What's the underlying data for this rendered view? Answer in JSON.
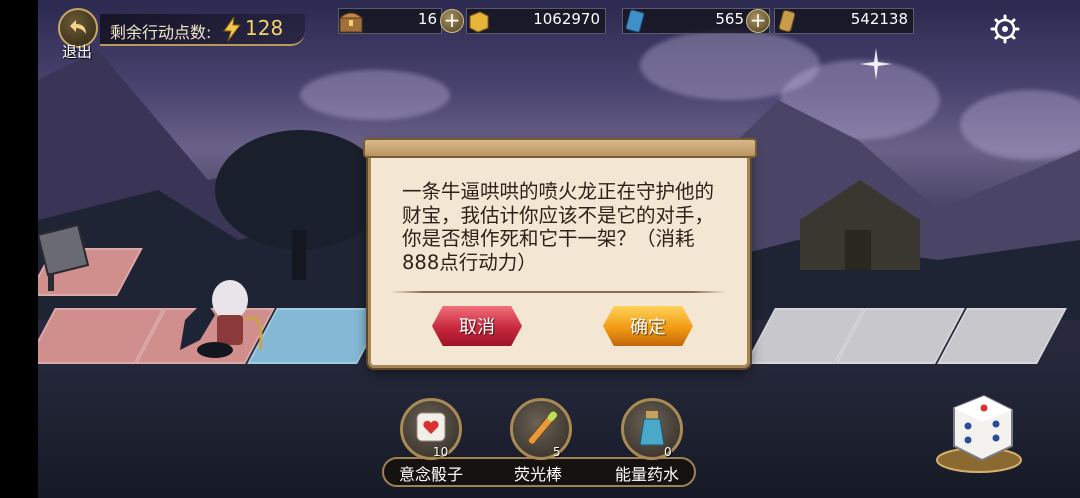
{
  "top_bar": {
    "exit_label": "退出",
    "action_points_label": "剩余行动点数:",
    "action_points_value": "128"
  },
  "resources": [
    {
      "icon": "treasure-chest-icon",
      "value": "16",
      "has_plus": true
    },
    {
      "icon": "gold-coin-icon",
      "value": "1062970",
      "has_plus": false
    },
    {
      "icon": "blue-gem-icon",
      "value": "565",
      "has_plus": true
    },
    {
      "icon": "bronze-coin-icon",
      "value": "542138",
      "has_plus": false
    }
  ],
  "dialog": {
    "message": "一条牛逼哄哄的喷火龙正在守护他的财宝，我估计你应该不是它的对手，你是否想作死和它干一架？（消耗888点行动力）",
    "cancel_label": "取消",
    "confirm_label": "确定"
  },
  "items": [
    {
      "icon": "heart-dice-icon",
      "count": "10",
      "label": "意念骰子"
    },
    {
      "icon": "glow-stick-icon",
      "count": "5",
      "label": "荧光棒"
    },
    {
      "icon": "potion-bottle-icon",
      "count": "0",
      "label": "能量药水"
    }
  ],
  "colors": {
    "accent_gold": "#f4d06a",
    "cancel_red": "#c7283d",
    "confirm_orange": "#f19a12",
    "dialog_bg": "#f3e7d4"
  }
}
